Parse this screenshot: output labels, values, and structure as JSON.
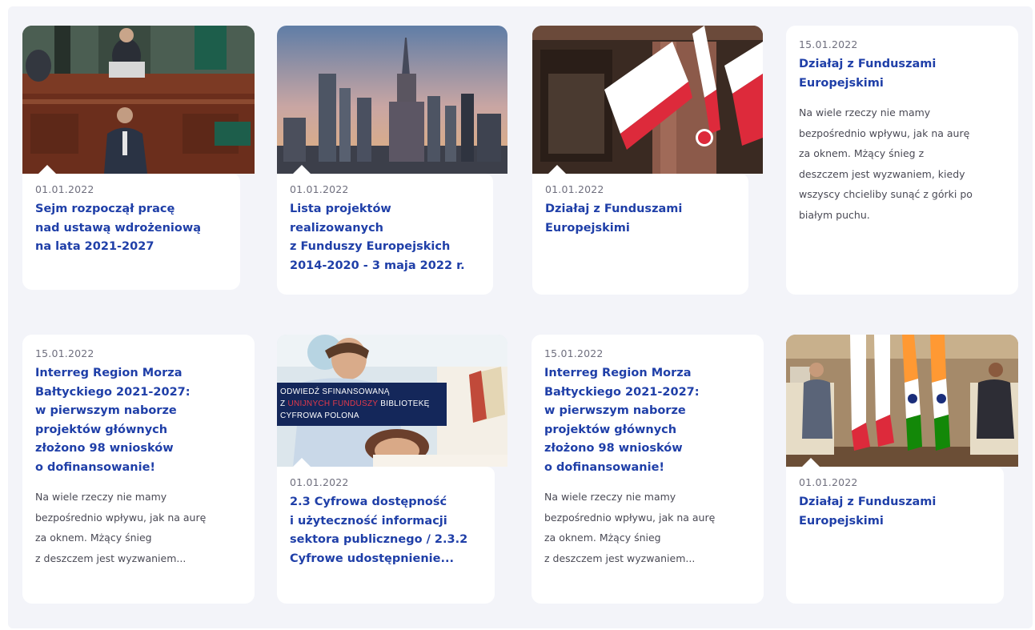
{
  "cards": [
    {
      "date": "01.01.2022",
      "title": "Sejm rozpoczął pracę\nnad ustawą wdrożeniową\nna lata 2021-2027",
      "image": "sejm-parliament-photo"
    },
    {
      "date": "01.01.2022",
      "title": "Lista projektów\nrealizowanych\nz Funduszy Europejskich\n2014-2020 - 3 maja 2022 r.",
      "image": "warsaw-skyline-photo"
    },
    {
      "date": "01.01.2022",
      "title": "Działaj z Funduszami\nEuropejskimi",
      "image": "polish-flags-photo"
    },
    {
      "date": "15.01.2022",
      "title": "Działaj z Funduszami\nEuropejskimi",
      "excerpt": "Na wiele rzeczy nie mamy\nbezpośrednio wpływu, jak na aurę\nza oknem. Mżący śnieg z\ndeszczem jest wyzwaniem, kiedy\nwszyscy chcieliby sunąć z górki po\nbiałym puchu."
    },
    {
      "date": "15.01.2022",
      "title": "Interreg Region Morza\nBałtyckiego 2021-2027:\nw pierwszym naborze\nprojektów głównych\nzłożono 98 wniosków\no dofinansowanie!",
      "excerpt": "Na wiele rzeczy nie mamy\nbezpośrednio wpływu, jak na aurę\nza oknem. Mżący śnieg\nz deszczem jest wyzwaniem..."
    },
    {
      "date": "01.01.2022",
      "title": "2.3 Cyfrowa dostępność\ni użyteczność informacji\nsektora publicznego / 2.3.2\nCyfrowe udostępnienie...",
      "image": "reading-woman-photo",
      "banner": {
        "line1": "ODWIEDŹ SFINANSOWANĄ",
        "line2_pre": "Z ",
        "line2_highlight": "UNIJNYCH FUNDUSZY",
        "line2_post": " BIBLIOTEKĘ",
        "line3": "CYFROWA POLONA"
      }
    },
    {
      "date": "15.01.2022",
      "title": "Interreg Region Morza\nBałtyckiego 2021-2027:\nw pierwszym naborze\nprojektów głównych\nzłożono 98 wniosków\no dofinansowanie!",
      "excerpt": "Na wiele rzeczy nie mamy\nbezpośrednio wpływu, jak na aurę\nza oknem. Mżący śnieg\nz deszczem jest wyzwaniem..."
    },
    {
      "date": "01.01.2022",
      "title": "Działaj z Funduszami\nEuropejskimi",
      "image": "diplomatic-meeting-photo"
    }
  ],
  "colors": {
    "title": "#1f3fa8",
    "background": "#f3f4f9",
    "card": "#ffffff",
    "banner": "#14275a",
    "banner_highlight": "#e23a4b"
  }
}
